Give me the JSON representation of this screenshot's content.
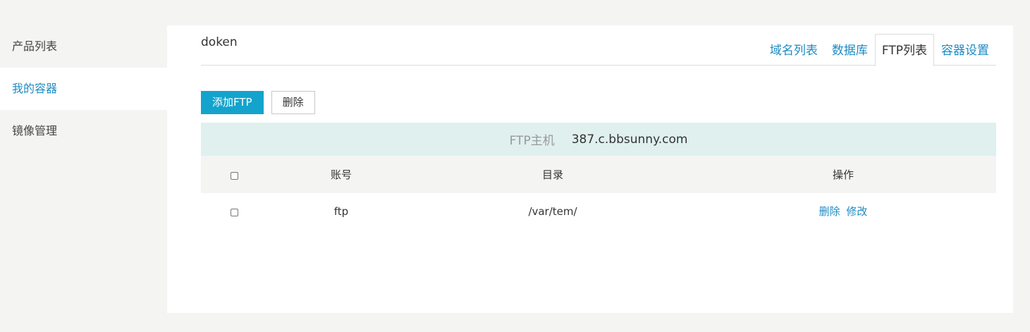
{
  "sidebar": {
    "items": [
      {
        "label": "产品列表",
        "active": false
      },
      {
        "label": "我的容器",
        "active": true
      },
      {
        "label": "镜像管理",
        "active": false
      }
    ]
  },
  "panel": {
    "container_name": "doken",
    "tabs": [
      {
        "label": "域名列表",
        "active": false
      },
      {
        "label": "数据库",
        "active": false
      },
      {
        "label": "FTP列表",
        "active": true
      },
      {
        "label": "容器设置",
        "active": false
      }
    ]
  },
  "toolbar": {
    "add_label": "添加FTP",
    "delete_label": "删除"
  },
  "host": {
    "label": "FTP主机",
    "value": "387.c.bbsunny.com"
  },
  "table": {
    "columns": {
      "account": "账号",
      "directory": "目录",
      "ops": "操作"
    },
    "rows": [
      {
        "account": "ftp",
        "directory": "/var/tem/",
        "delete": "删除",
        "edit": "修改"
      }
    ]
  },
  "colors": {
    "accent": "#1e8bc3",
    "primary_button": "#14a3cc",
    "host_bar": "#dff0ee",
    "page_bg": "#f4f4f2"
  }
}
